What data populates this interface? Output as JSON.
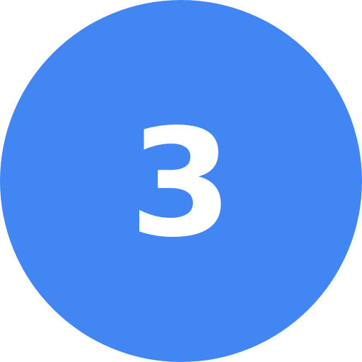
{
  "badge": {
    "number": "3",
    "background_color": "#4286F4",
    "text_color": "#FFFFFF"
  }
}
